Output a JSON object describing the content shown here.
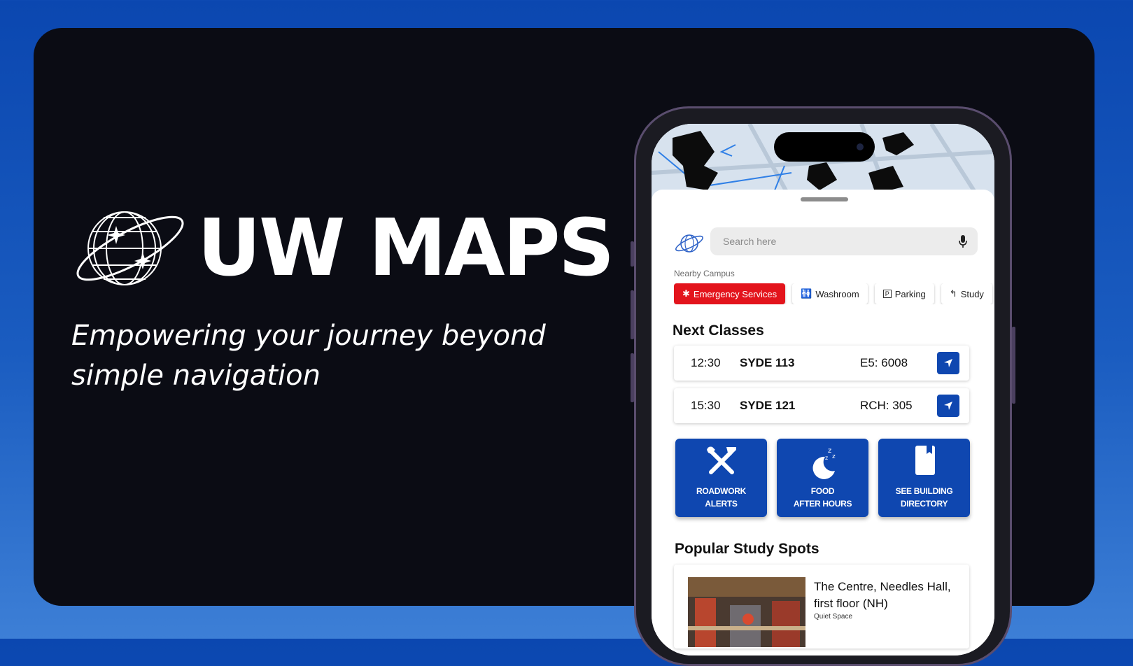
{
  "brand": {
    "title": "UW MAPS",
    "tagline_line1": "Empowering your journey beyond",
    "tagline_line2": "simple navigation"
  },
  "app": {
    "search": {
      "placeholder": "Search here"
    },
    "nearby_label": "Nearby Campus",
    "chips": [
      {
        "label": "Emergency Services",
        "icon": "asterisk-icon"
      },
      {
        "label": "Washroom",
        "icon": "washroom-icon"
      },
      {
        "label": "Parking",
        "icon": "parking-icon"
      },
      {
        "label": "Study",
        "icon": "study-icon"
      }
    ],
    "next_classes_title": "Next Classes",
    "classes": [
      {
        "time": "12:30",
        "course": "SYDE 113",
        "room": "E5: 6008"
      },
      {
        "time": "15:30",
        "course": "SYDE 121",
        "room": "RCH: 305"
      }
    ],
    "tiles": [
      {
        "line1": "ROADWORK",
        "line2": "ALERTS",
        "icon": "tools-icon"
      },
      {
        "line1": "FOOD",
        "line2": "AFTER HOURS",
        "icon": "moon-sleep-icon"
      },
      {
        "line1": "SEE BUILDING",
        "line2": "DIRECTORY",
        "icon": "book-icon"
      }
    ],
    "study_title": "Popular Study Spots",
    "spot": {
      "title": "The Centre, Needles Hall, first floor (NH)",
      "subtitle": "Quiet Space"
    }
  },
  "colors": {
    "accent": "#0f47b0",
    "emergency": "#e3141c",
    "card_bg": "#0b0c14"
  }
}
